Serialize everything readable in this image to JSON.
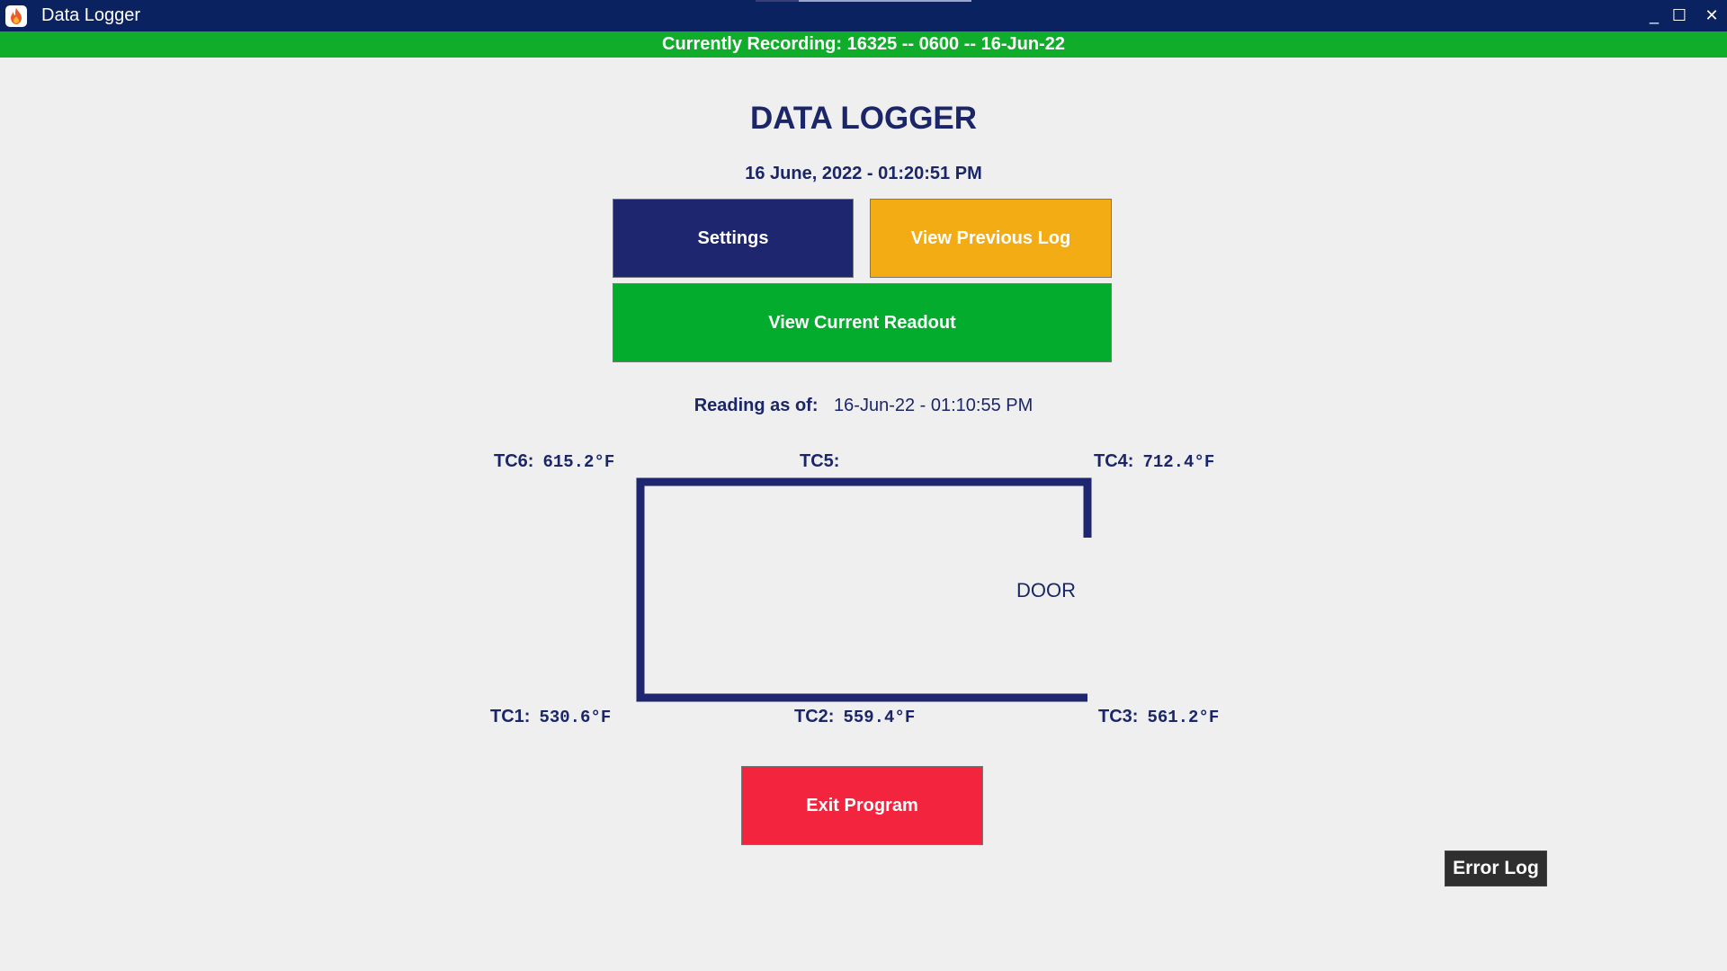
{
  "window": {
    "title": "Data Logger",
    "controls": {
      "minimize": "_",
      "maximize": "☐",
      "close": "✕"
    }
  },
  "banner": {
    "text": "Currently Recording: 16325 -- 0600 -- 16-Jun-22",
    "color": "#10ad2a"
  },
  "main": {
    "heading": "DATA LOGGER",
    "datetime": "16 June, 2022 - 01:20:51 PM"
  },
  "buttons": {
    "settings": "Settings",
    "view_previous_log": "View Previous Log",
    "view_current_readout": "View Current Readout",
    "exit_program": "Exit Program",
    "error_log": "Error Log"
  },
  "reading": {
    "label": "Reading as of:",
    "value": "16-Jun-22 - 01:10:55 PM"
  },
  "thermocouples": {
    "tc1": {
      "name": "TC1:",
      "value": "530.6°F"
    },
    "tc2": {
      "name": "TC2:",
      "value": "559.4°F"
    },
    "tc3": {
      "name": "TC3:",
      "value": "561.2°F"
    },
    "tc4": {
      "name": "TC4:",
      "value": "712.4°F"
    },
    "tc5": {
      "name": "TC5:",
      "value": ""
    },
    "tc6": {
      "name": "TC6:",
      "value": "615.2°F"
    }
  },
  "diagram": {
    "door_label": "DOOR"
  },
  "colors": {
    "titlebar": "#0a2260",
    "navy": "#1b2668",
    "settings_button": "#1f2670",
    "previous_log_button": "#f4ac14",
    "readout_button": "#03ac2c",
    "exit_button": "#f3243e",
    "error_log_button": "#2f2f2f"
  },
  "icons": {
    "app": "flame-icon"
  }
}
